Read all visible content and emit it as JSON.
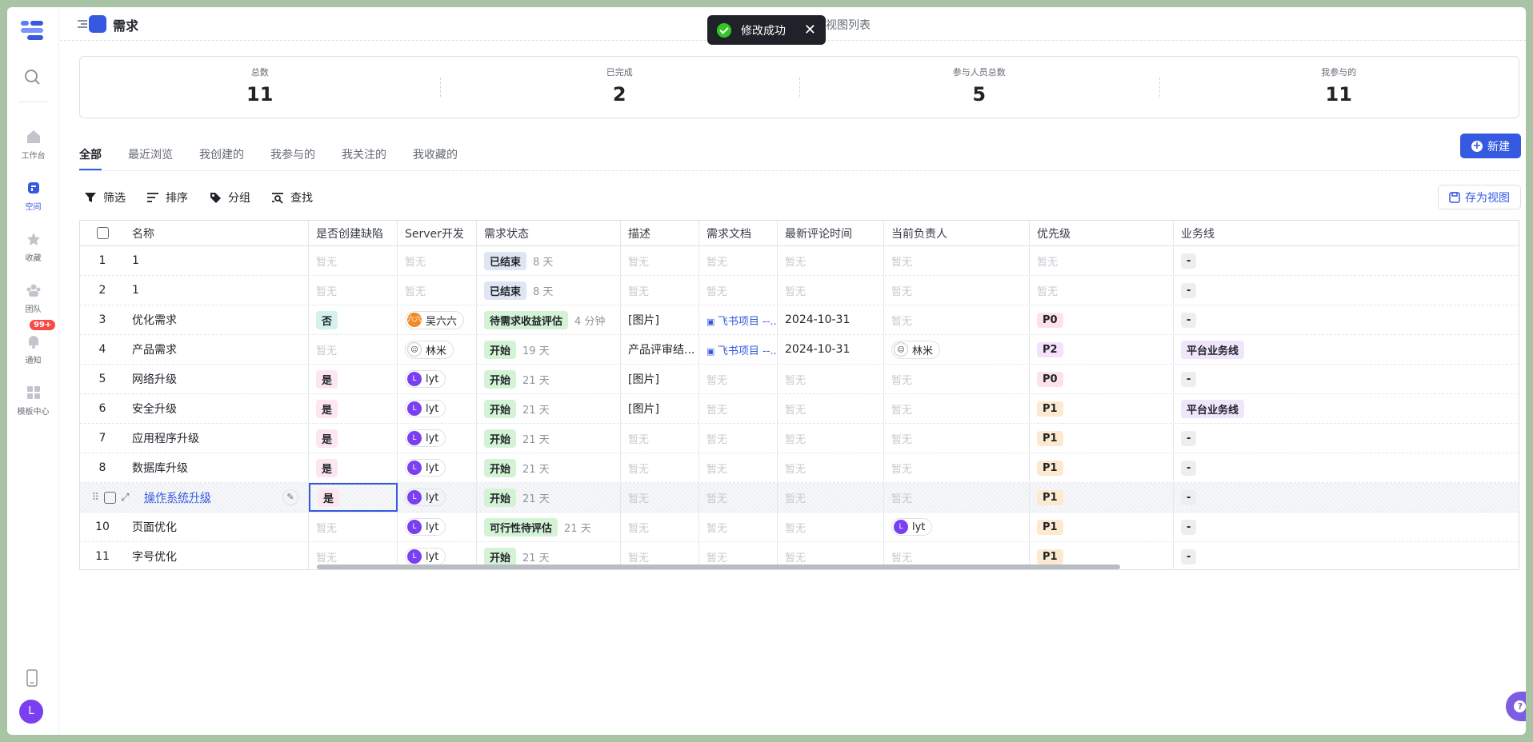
{
  "header": {
    "title": "需求",
    "view_list": "视图列表"
  },
  "toast": {
    "message": "修改成功"
  },
  "nav": {
    "items": [
      "工作台",
      "空间",
      "收藏",
      "团队",
      "通知",
      "模板中心"
    ],
    "badge": "99+",
    "avatar": "L"
  },
  "stats": [
    {
      "label": "总数",
      "value": "11"
    },
    {
      "label": "已完成",
      "value": "2"
    },
    {
      "label": "参与人员总数",
      "value": "5"
    },
    {
      "label": "我参与的",
      "value": "11"
    }
  ],
  "tabs": [
    "全部",
    "最近浏览",
    "我创建的",
    "我参与的",
    "我关注的",
    "我收藏的"
  ],
  "buttons": {
    "new": "新建",
    "save_view": "存为视图",
    "help": "帮助"
  },
  "toolbar": [
    "筛选",
    "排序",
    "分组",
    "查找"
  ],
  "columns": [
    "名称",
    "是否创建缺陷",
    "Server开发",
    "需求状态",
    "描述",
    "需求文档",
    "最新评论时间",
    "当前负责人",
    "优先级",
    "业务线"
  ],
  "empty": "暂无",
  "rows": [
    {
      "idx": "1",
      "name": "1",
      "defect": "",
      "dev": "",
      "dev_av": "",
      "status": "已结束",
      "age": "8 天",
      "desc": "",
      "doc": "",
      "comment": "",
      "owner": "",
      "owner_av": "",
      "priority": "",
      "biz": "-"
    },
    {
      "idx": "2",
      "name": "1",
      "defect": "",
      "dev": "",
      "dev_av": "",
      "status": "已结束",
      "age": "8 天",
      "desc": "",
      "doc": "",
      "comment": "",
      "owner": "",
      "owner_av": "",
      "priority": "",
      "biz": "-"
    },
    {
      "idx": "3",
      "name": "优化需求",
      "defect": "否",
      "dev": "吴六六",
      "dev_av": "六六",
      "status": "待需求收益评估",
      "age": "4 分钟",
      "desc": "[图片]",
      "doc": "飞书项目 --...",
      "comment": "2024-10-31",
      "owner": "",
      "owner_av": "",
      "priority": "P0",
      "biz": "-"
    },
    {
      "idx": "4",
      "name": "产品需求",
      "defect": "",
      "dev": "林米",
      "dev_av": "☺",
      "status": "开始",
      "age": "19 天",
      "desc": "产品评审结...",
      "doc": "飞书项目 --...",
      "comment": "2024-10-31",
      "owner": "林米",
      "owner_av": "☺",
      "priority": "P2",
      "biz": "平台业务线"
    },
    {
      "idx": "5",
      "name": "网络升级",
      "defect": "是",
      "dev": "lyt",
      "dev_av": "L",
      "status": "开始",
      "age": "21 天",
      "desc": "[图片]",
      "doc": "",
      "comment": "",
      "owner": "",
      "owner_av": "",
      "priority": "P0",
      "biz": "-"
    },
    {
      "idx": "6",
      "name": "安全升级",
      "defect": "是",
      "dev": "lyt",
      "dev_av": "L",
      "status": "开始",
      "age": "21 天",
      "desc": "[图片]",
      "doc": "",
      "comment": "",
      "owner": "",
      "owner_av": "",
      "priority": "P1",
      "biz": "平台业务线"
    },
    {
      "idx": "7",
      "name": "应用程序升级",
      "defect": "是",
      "dev": "lyt",
      "dev_av": "L",
      "status": "开始",
      "age": "21 天",
      "desc": "",
      "doc": "",
      "comment": "",
      "owner": "",
      "owner_av": "",
      "priority": "P1",
      "biz": "-"
    },
    {
      "idx": "8",
      "name": "数据库升级",
      "defect": "是",
      "dev": "lyt",
      "dev_av": "L",
      "status": "开始",
      "age": "21 天",
      "desc": "",
      "doc": "",
      "comment": "",
      "owner": "",
      "owner_av": "",
      "priority": "P1",
      "biz": "-"
    },
    {
      "idx": "",
      "name": "操作系统升级",
      "defect": "是",
      "dev": "lyt",
      "dev_av": "L",
      "status": "开始",
      "age": "21 天",
      "desc": "",
      "doc": "",
      "comment": "",
      "owner": "",
      "owner_av": "",
      "priority": "P1",
      "biz": "-"
    },
    {
      "idx": "10",
      "name": "页面优化",
      "defect": "",
      "dev": "lyt",
      "dev_av": "L",
      "status": "可行性待评估",
      "age": "21 天",
      "desc": "",
      "doc": "",
      "comment": "",
      "owner": "lyt",
      "owner_av": "L",
      "priority": "P1",
      "biz": "-"
    },
    {
      "idx": "11",
      "name": "字号优化",
      "defect": "",
      "dev": "lyt",
      "dev_av": "L",
      "status": "开始",
      "age": "21 天",
      "desc": "",
      "doc": "",
      "comment": "",
      "owner": "",
      "owner_av": "",
      "priority": "P1",
      "biz": "-"
    }
  ]
}
